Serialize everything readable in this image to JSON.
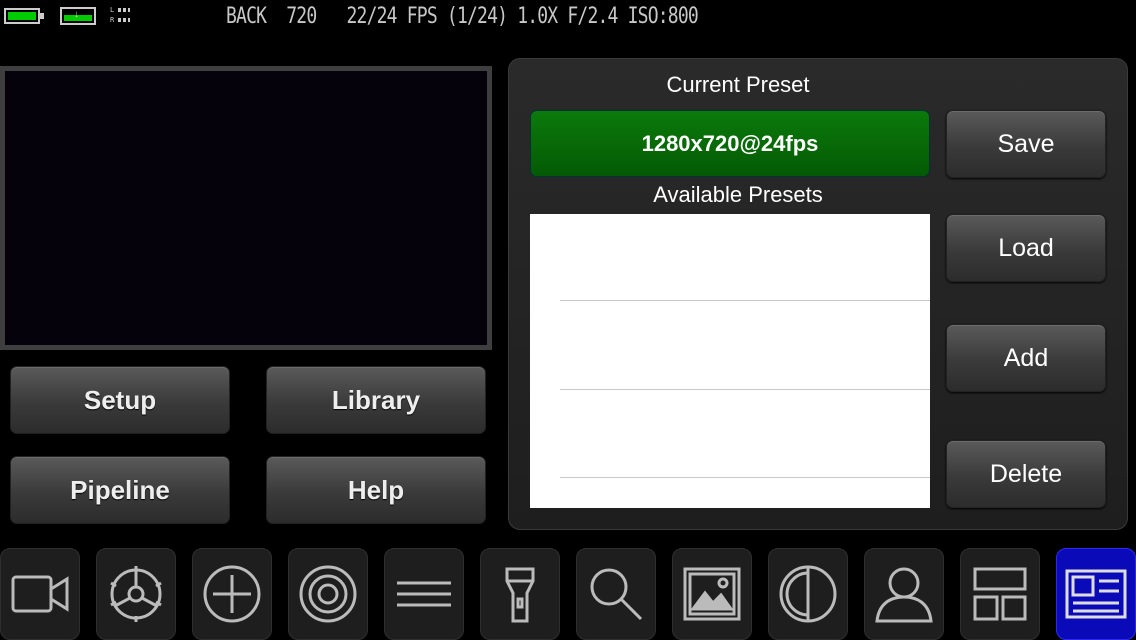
{
  "status": {
    "text": "BACK  720   22/24 FPS (1/24) 1.0X F/2.4 ISO:800",
    "audio_left": "L",
    "audio_right": "R"
  },
  "nav": {
    "setup": "Setup",
    "library": "Library",
    "pipeline": "Pipeline",
    "help": "Help"
  },
  "presets": {
    "current_title": "Current Preset",
    "current_value": "1280x720@24fps",
    "available_title": "Available Presets",
    "items": [],
    "actions": {
      "save": "Save",
      "load": "Load",
      "add": "Add",
      "delete": "Delete"
    }
  },
  "toolbar": {
    "icons": [
      "video-camera-icon",
      "gear-icon",
      "crosshair-icon",
      "target-icon",
      "menu-icon",
      "flashlight-icon",
      "search-icon",
      "image-icon",
      "contrast-icon",
      "person-icon",
      "layout-icon",
      "news-icon"
    ],
    "active": "news-icon"
  },
  "colors": {
    "accent_green": "#0b7a0b",
    "active_tool": "#0a0ab8",
    "battery": "#00cc00"
  }
}
